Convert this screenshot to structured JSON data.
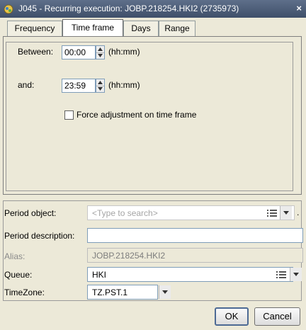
{
  "window": {
    "title": "J045 - Recurring execution: JOBP.218254.HKI2 (2735973)"
  },
  "tabs": [
    {
      "label": "Frequency"
    },
    {
      "label": "Time frame"
    },
    {
      "label": "Days"
    },
    {
      "label": "Range"
    }
  ],
  "active_tab": "Time frame",
  "time_frame": {
    "between_label": "Between:",
    "between_value": "00:00",
    "between_unit": "(hh:mm)",
    "and_label": "and:",
    "and_value": "23:59",
    "and_unit": "(hh:mm)",
    "force_adjustment_label": "Force adjustment on time frame",
    "force_adjustment_checked": false
  },
  "form": {
    "period_object_label": "Period object:",
    "period_object_placeholder": "<Type to search>",
    "period_object_trailing": ".",
    "period_description_label": "Period description:",
    "period_description_value": "",
    "alias_label": "Alias:",
    "alias_value": "JOBP.218254.HKI2",
    "queue_label": "Queue:",
    "queue_value": "HKI",
    "timezone_label": "TimeZone:",
    "timezone_value": "TZ.PST.1"
  },
  "buttons": {
    "ok": "OK",
    "cancel": "Cancel"
  },
  "icons": [
    "app-icon",
    "close-icon",
    "spin-up-icon",
    "spin-down-icon",
    "list-icon",
    "chevron-down-icon"
  ]
}
